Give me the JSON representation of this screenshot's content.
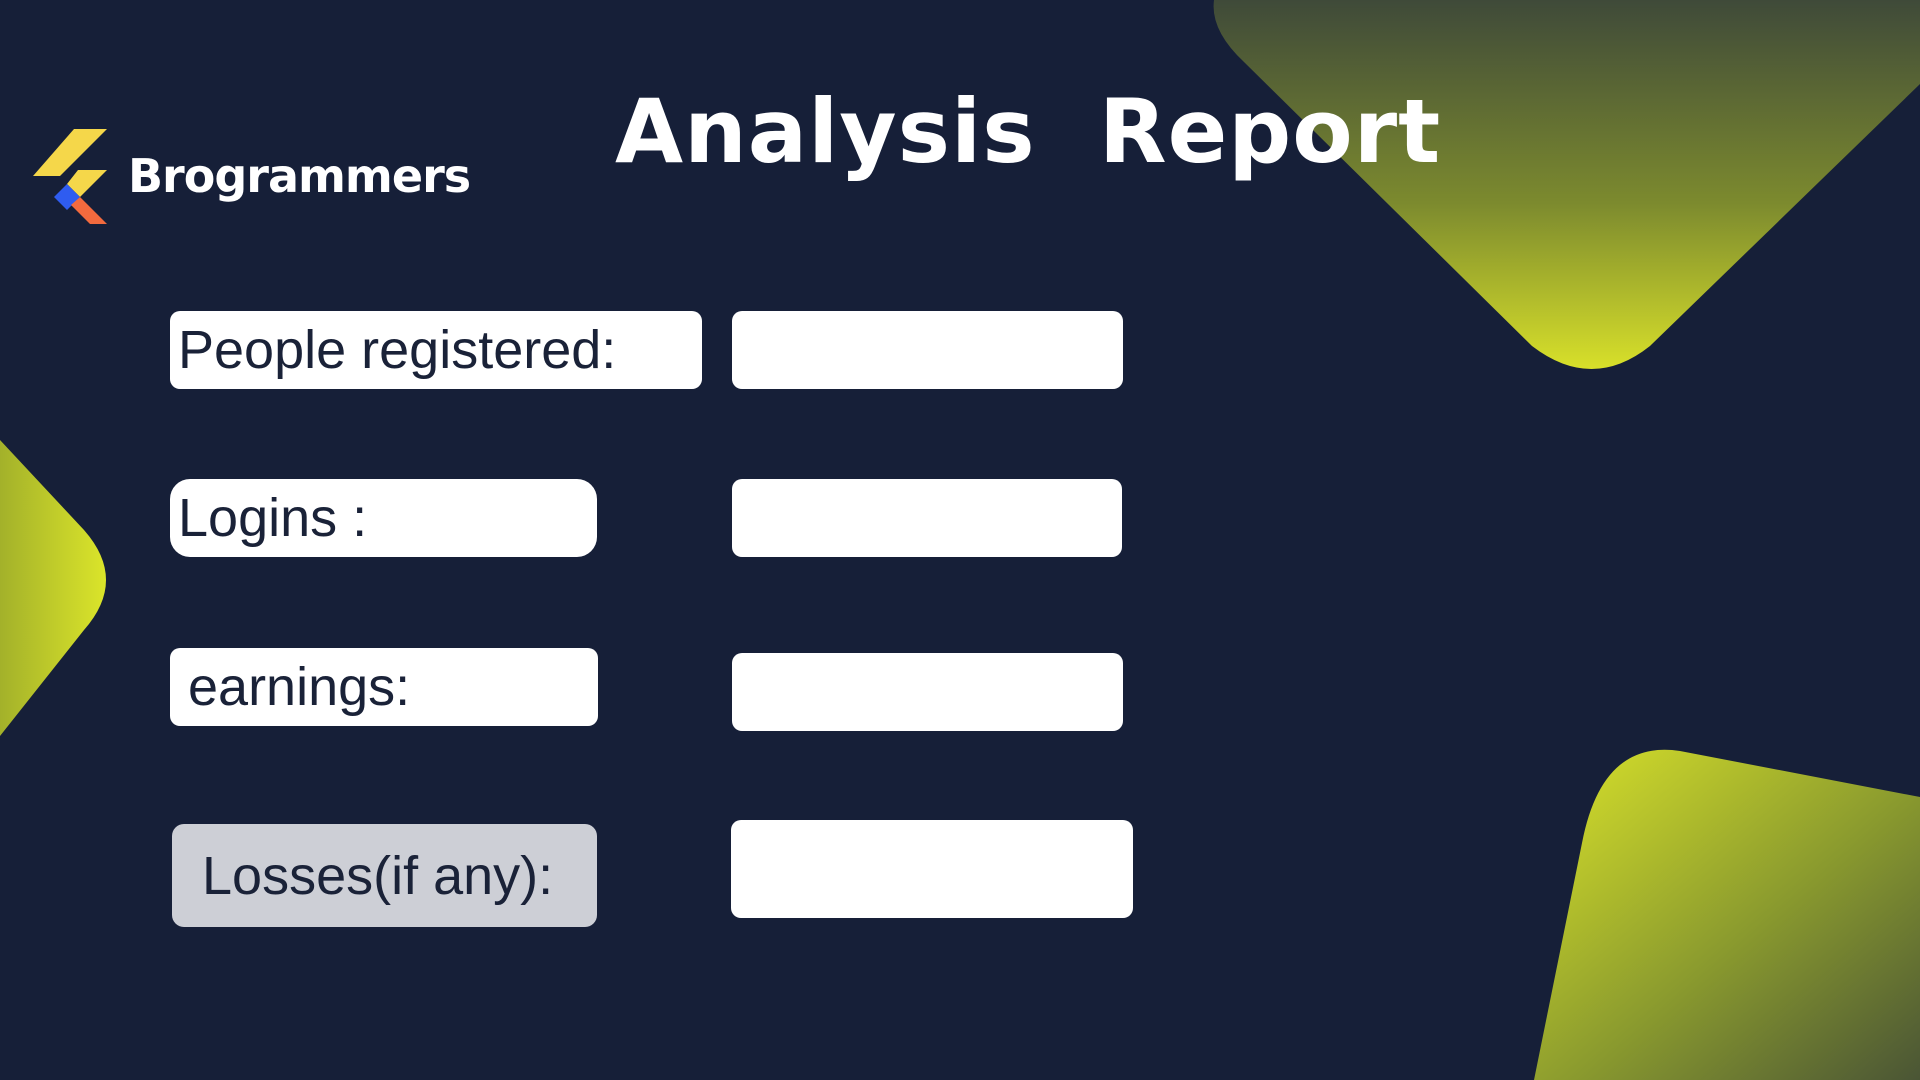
{
  "brand": {
    "name": "Brogrammers",
    "logo_icon": "flutter-logo-icon"
  },
  "page_title": "Analysis  Report",
  "colors": {
    "background": "#161f38",
    "accent_yellow": "#d7e12a",
    "accent_olive": "#4c5a35",
    "label_text": "#1a2238",
    "muted_label_bg": "#cdcfd6"
  },
  "form": {
    "people_registered": {
      "label": "People registered:",
      "value": ""
    },
    "logins": {
      "label": "Logins :",
      "value": ""
    },
    "earnings": {
      "label": "earnings:",
      "value": ""
    },
    "losses": {
      "label": "Losses(if any):",
      "value": ""
    }
  }
}
